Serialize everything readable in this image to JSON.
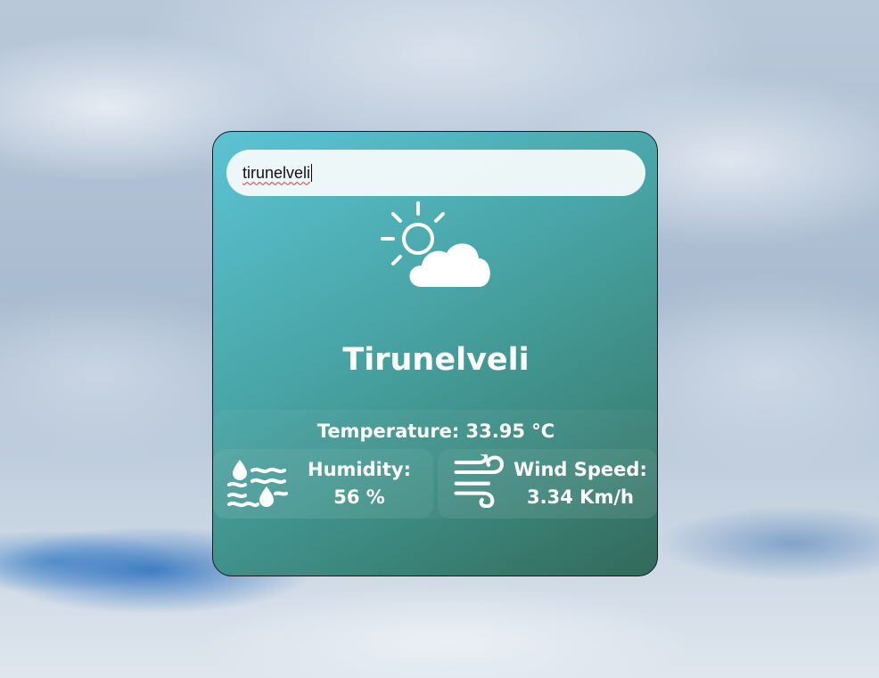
{
  "search": {
    "value": "tirunelveli",
    "placeholder": ""
  },
  "weather": {
    "icon": "partly-cloudy-icon",
    "city": "Tirunelveli",
    "temperature_text": "Temperature: 33.95 °C",
    "humidity_label": "Humidity:",
    "humidity_value": "56 %",
    "humidity_icon": "humidity-icon",
    "wind_label": "Wind Speed:",
    "wind_value": "3.34 Km/h",
    "wind_icon": "wind-icon"
  },
  "colors": {
    "card_gradient_start": "#5cc3d4",
    "card_gradient_end": "#33695a",
    "text": "#ffffff"
  }
}
